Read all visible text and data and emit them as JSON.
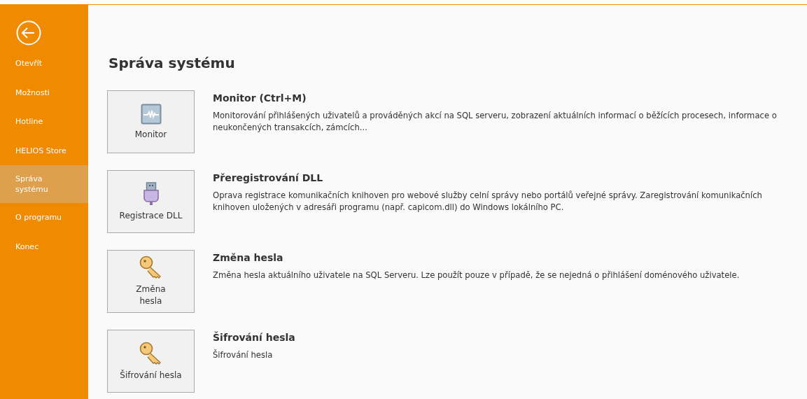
{
  "sidebar": {
    "items": [
      {
        "label": "Otevřít",
        "selected": false
      },
      {
        "label": "Možnosti",
        "selected": false
      },
      {
        "label": "Hotline",
        "selected": false
      },
      {
        "label": "HELIOS Store",
        "selected": false
      },
      {
        "label": "Správa\nsystému",
        "selected": true
      },
      {
        "label": "O programu",
        "selected": false
      },
      {
        "label": "Konec",
        "selected": false
      }
    ]
  },
  "page": {
    "title": "Správa systému",
    "actions": [
      {
        "kind": "monitor",
        "button": "Monitor",
        "title": "Monitor (Ctrl+M)",
        "description": "Monitorování přihlášených uživatelů a prováděných akcí na SQL serveru, zobrazení aktuálních informací o běžících procesech, informace o neukončených transakcích, zámcích..."
      },
      {
        "kind": "plug",
        "button": "Registrace DLL",
        "title": "Přeregistrování DLL",
        "description": "Oprava registrace komunikačních knihoven pro webové služby celní správy nebo portálů veřejné správy. Zaregistrování komunikačních knihoven uložených v adresáři programu (např. capicom.dll) do Windows lokálního PC."
      },
      {
        "kind": "key",
        "button": "Změna\nhesla",
        "title": "Změna hesla",
        "description": "Změna hesla aktuálního uživatele na SQL Serveru. Lze použít pouze v případě, že se nejedná o přihlášení doménového uživatele."
      },
      {
        "kind": "key",
        "button": "Šifrování hesla",
        "title": "Šifrování hesla",
        "description": "Šifrování hesla"
      }
    ]
  }
}
